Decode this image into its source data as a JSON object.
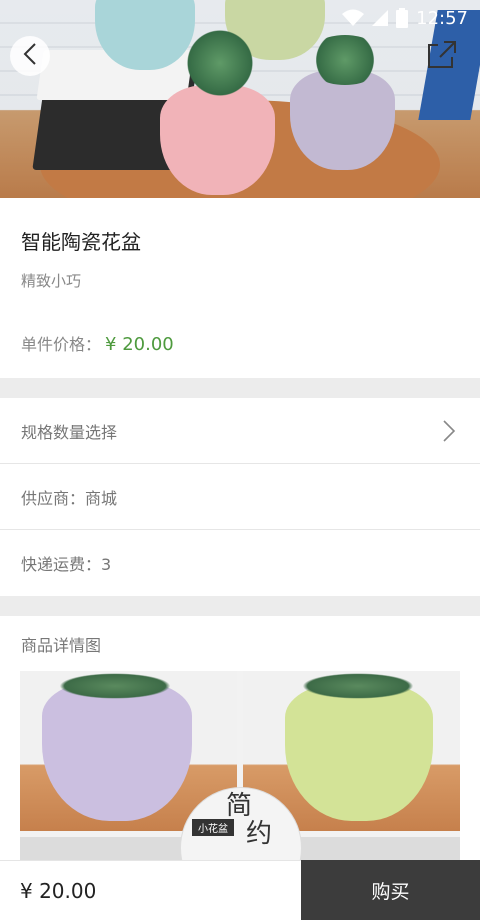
{
  "status_bar": {
    "time": "12:57"
  },
  "hero": {
    "back_icon": "chevron-left-icon",
    "share_icon": "share-icon"
  },
  "product": {
    "title": "智能陶瓷花盆",
    "subtitle": "精致小巧",
    "price_label": "单件价格：",
    "price_value": "¥ 20.00"
  },
  "options": {
    "spec_select": "规格数量选择",
    "supplier": "供应商：商城",
    "shipping": "快递运费：3"
  },
  "details": {
    "label": "商品详情图",
    "badge_char_1": "简",
    "badge_char_2": "约",
    "badge_tag": "小花盆"
  },
  "bottom_bar": {
    "price": "¥ 20.00",
    "buy_label": "购买"
  },
  "colors": {
    "price_green": "#4e9a3e",
    "buy_button": "#3c3c3c"
  }
}
